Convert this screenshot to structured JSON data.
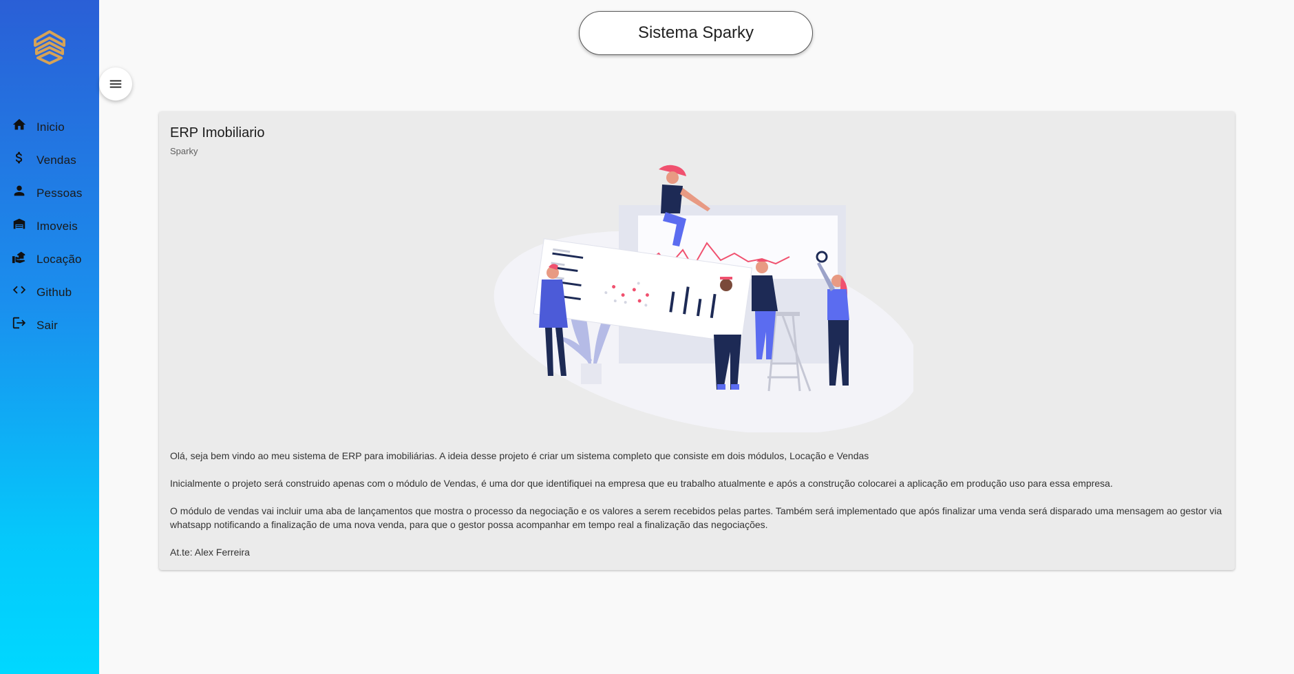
{
  "app": {
    "title": "Sistema Sparky"
  },
  "sidebar": {
    "logo_icon": "stacked-chevrons-logo",
    "items": [
      {
        "label": "Inicio",
        "icon": "home-icon"
      },
      {
        "label": "Vendas",
        "icon": "dollar-icon"
      },
      {
        "label": "Pessoas",
        "icon": "person-icon"
      },
      {
        "label": "Imoveis",
        "icon": "house-siding-icon"
      },
      {
        "label": "Locação",
        "icon": "real-estate-agent-icon"
      },
      {
        "label": "Github",
        "icon": "code-icon"
      },
      {
        "label": "Sair",
        "icon": "logout-icon"
      }
    ]
  },
  "menu_button": {
    "icon": "hamburger-menu-icon"
  },
  "card": {
    "title": "ERP Imobiliario",
    "subtitle": "Sparky",
    "paragraphs": [
      "Olá, seja bem vindo ao meu sistema de ERP para imobiliárias. A ideia desse projeto é criar um sistema completo que consiste em dois módulos, Locação e Vendas",
      "Inicialmente o projeto será construido apenas com o módulo de Vendas, é uma dor que identifiquei na empresa que eu trabalho atualmente e após a construção colocarei a aplicação em produção uso para essa empresa.",
      "O módulo de vendas vai incluir uma aba de lançamentos que mostra o processo da negociação e os valores a serem recebidos pelas partes. Também será implementado que após finalizar uma venda será disparado uma mensagem ao gestor via whatsapp notificando a finalização de uma nova venda, para que o gestor possa acompanhar em tempo real a finalização das negociações.",
      "At.te: Alex Ferreira"
    ]
  },
  "colors": {
    "sidebar_gradient_top": "#2a5fd6",
    "sidebar_gradient_bottom": "#00d8ff",
    "logo": "#d6a357",
    "card_background": "#ebebeb",
    "page_background": "#f9f9f9",
    "illustration_accent": "#5b6cf0",
    "illustration_pink": "#f0516f"
  }
}
